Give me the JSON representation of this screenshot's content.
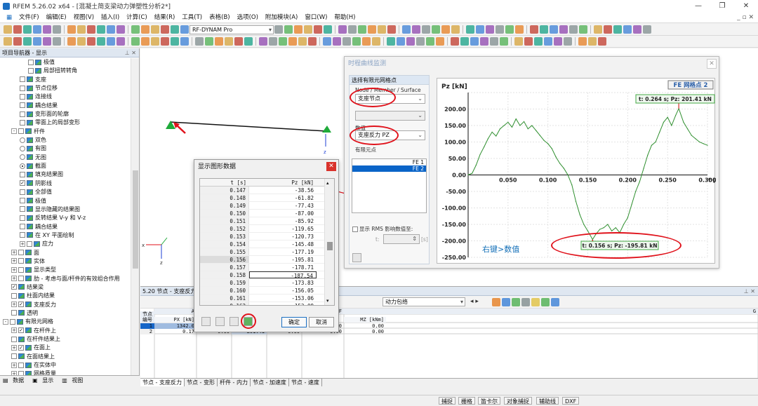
{
  "app": {
    "title": "RFEM 5.26.02 x64 - [混凝土简支梁动力弹塑性分析2*]"
  },
  "menu": [
    "文件(F)",
    "编辑(E)",
    "视图(V)",
    "插入(I)",
    "计算(C)",
    "结果(R)",
    "工具(T)",
    "表格(B)",
    "选项(O)",
    "附加模块(A)",
    "窗口(W)",
    "帮助(H)"
  ],
  "toolbar": {
    "module_select": "RF-DYNAM Pro"
  },
  "navigator": {
    "title": "项目导航器 - 显示",
    "items": [
      {
        "label": "极值",
        "indent": 3,
        "kind": "check",
        "checked": false
      },
      {
        "label": "局部扭转转角",
        "indent": 3,
        "kind": "check",
        "checked": false
      },
      {
        "label": "支座",
        "indent": 2,
        "kind": "check",
        "checked": false
      },
      {
        "label": "节点位移",
        "indent": 2,
        "kind": "check",
        "checked": false
      },
      {
        "label": "连接线",
        "indent": 2,
        "kind": "check",
        "checked": false
      },
      {
        "label": "耦合结果",
        "indent": 2,
        "kind": "check",
        "checked": false
      },
      {
        "label": "变形面的轮廓",
        "indent": 2,
        "kind": "check",
        "checked": false
      },
      {
        "label": "零面上的局部变形",
        "indent": 2,
        "kind": "check",
        "checked": false
      },
      {
        "label": "杆件",
        "indent": 1,
        "kind": "check",
        "checked": false,
        "expander": "-"
      },
      {
        "label": "双色",
        "indent": 2,
        "kind": "radio",
        "checked": false
      },
      {
        "label": "有图",
        "indent": 2,
        "kind": "radio",
        "checked": false
      },
      {
        "label": "无图",
        "indent": 2,
        "kind": "radio",
        "checked": false
      },
      {
        "label": "截面",
        "indent": 2,
        "kind": "radio",
        "checked": true
      },
      {
        "label": "填充结果图",
        "indent": 2,
        "kind": "check",
        "checked": false
      },
      {
        "label": "阴影线",
        "indent": 2,
        "kind": "check",
        "checked": true
      },
      {
        "label": "全部值",
        "indent": 2,
        "kind": "check",
        "checked": false
      },
      {
        "label": "极值",
        "indent": 2,
        "kind": "check",
        "checked": false
      },
      {
        "label": "显示隐藏的结果图",
        "indent": 2,
        "kind": "check",
        "checked": false
      },
      {
        "label": "反转结果 V-y 和 V-z",
        "indent": 2,
        "kind": "check",
        "checked": false
      },
      {
        "label": "耦合结果",
        "indent": 2,
        "kind": "check",
        "checked": false
      },
      {
        "label": "在 XY 平面绘制",
        "indent": 2,
        "kind": "check",
        "checked": false
      },
      {
        "label": "应力",
        "indent": 2,
        "kind": "check",
        "checked": false,
        "expander": "+"
      },
      {
        "label": "面",
        "indent": 1,
        "kind": "check",
        "checked": false,
        "expander": "+"
      },
      {
        "label": "实体",
        "indent": 1,
        "kind": "check",
        "checked": false,
        "expander": "+"
      },
      {
        "label": "显示类型",
        "indent": 1,
        "kind": "check",
        "checked": false,
        "expander": "+"
      },
      {
        "label": "肋 - 考虑与面/杆件的有效组合作用",
        "indent": 1,
        "kind": "check",
        "checked": false,
        "expander": "+"
      },
      {
        "label": "结果梁",
        "indent": 1,
        "kind": "check",
        "checked": true
      },
      {
        "label": "柱面内结果",
        "indent": 1,
        "kind": "check",
        "checked": false
      },
      {
        "label": "支座反力",
        "indent": 1,
        "kind": "check",
        "checked": true,
        "expander": "+"
      },
      {
        "label": "透明",
        "indent": 1,
        "kind": "check",
        "checked": false
      },
      {
        "label": "有限元网格",
        "indent": 0,
        "kind": "check",
        "checked": false,
        "expander": "-"
      },
      {
        "label": "在杆件上",
        "indent": 1,
        "kind": "check",
        "checked": true,
        "expander": "+"
      },
      {
        "label": "在杆件结果上",
        "indent": 1,
        "kind": "check",
        "checked": false
      },
      {
        "label": "在面上",
        "indent": 1,
        "kind": "check",
        "checked": true,
        "expander": "+"
      },
      {
        "label": "在面结果上",
        "indent": 1,
        "kind": "check",
        "checked": false
      },
      {
        "label": "在实体中",
        "indent": 1,
        "kind": "check",
        "checked": false,
        "expander": "+"
      },
      {
        "label": "网格质量",
        "indent": 1,
        "kind": "check",
        "checked": false,
        "expander": "+"
      }
    ],
    "tabs": [
      "数据",
      "显示",
      "视图"
    ]
  },
  "time_monitor": {
    "title": "时程曲线监测",
    "select_title": "选择有限元网格点",
    "member_label": "Node / Member / Surface",
    "member_value": "支座节点",
    "value_label": "数值",
    "value_value": "支座反力 PZ",
    "fe_label": "有限元点",
    "fe_items": [
      "FE 1",
      "FE 2"
    ],
    "fe_selected": 1,
    "rms_label": "显示 RMS 影响数值至:",
    "t_label": "t:",
    "t_unit": "[s]",
    "annotation": "右键>数值"
  },
  "chart_data": {
    "type": "line",
    "title": "FE 网格点 2",
    "ylabel": "Pz [kN]",
    "xlabel": "t [s]",
    "xlim": [
      0,
      0.3
    ],
    "ylim": [
      -250,
      250
    ],
    "xticks": [
      "0.050",
      "0.100",
      "0.150",
      "0.200",
      "0.250",
      "0.300"
    ],
    "yticks": [
      "200.00",
      "150.00",
      "100.00",
      "50.00",
      "0.00",
      "-50.00",
      "-100.00",
      "-150.00",
      "-200.00",
      "-250.00"
    ],
    "max_label": "t: 0.264 s; Pz: 201.41 kN",
    "min_label": "t: 0.156 s; Pz: -195.81 kN",
    "grid": true,
    "x": [
      0,
      0.005,
      0.01,
      0.015,
      0.02,
      0.025,
      0.03,
      0.035,
      0.04,
      0.045,
      0.05,
      0.055,
      0.06,
      0.065,
      0.07,
      0.075,
      0.08,
      0.085,
      0.09,
      0.095,
      0.1,
      0.105,
      0.11,
      0.115,
      0.12,
      0.125,
      0.13,
      0.135,
      0.14,
      0.145,
      0.15,
      0.156,
      0.16,
      0.165,
      0.17,
      0.175,
      0.18,
      0.185,
      0.19,
      0.195,
      0.2,
      0.205,
      0.21,
      0.215,
      0.22,
      0.225,
      0.23,
      0.235,
      0.24,
      0.245,
      0.25,
      0.255,
      0.26,
      0.264,
      0.27,
      0.275,
      0.28,
      0.285,
      0.29,
      0.295,
      0.3
    ],
    "y": [
      0,
      5,
      30,
      62,
      85,
      110,
      130,
      118,
      140,
      150,
      160,
      145,
      170,
      150,
      162,
      140,
      150,
      135,
      120,
      105,
      95,
      80,
      55,
      35,
      20,
      0,
      -30,
      -80,
      -120,
      -150,
      -170,
      -195.81,
      -180,
      -165,
      -160,
      -150,
      -170,
      -160,
      -175,
      -150,
      -130,
      -90,
      -50,
      -20,
      20,
      60,
      90,
      100,
      130,
      160,
      175,
      150,
      180,
      201.41,
      160,
      140,
      120,
      110,
      100,
      95,
      90
    ]
  },
  "data_dialog": {
    "title": "显示图形数据",
    "col_t": "t [s]",
    "col_p": "Pz [kN]",
    "rows": [
      [
        "0.147",
        "-38.56"
      ],
      [
        "0.148",
        "-61.82"
      ],
      [
        "0.149",
        "-77.43"
      ],
      [
        "0.150",
        "-87.00"
      ],
      [
        "0.151",
        "-85.92"
      ],
      [
        "0.152",
        "-119.65"
      ],
      [
        "0.153",
        "-120.73"
      ],
      [
        "0.154",
        "-145.48"
      ],
      [
        "0.155",
        "-177.19"
      ],
      [
        "0.156",
        "-195.81"
      ],
      [
        "0.157",
        "-178.71"
      ],
      [
        "0.158",
        "-187.54"
      ],
      [
        "0.159",
        "-173.83"
      ],
      [
        "0.160",
        "-156.05"
      ],
      [
        "0.161",
        "-153.06"
      ],
      [
        "0.162",
        "-153.09"
      ],
      [
        "0.163",
        "-115.18"
      ]
    ],
    "ok": "确定",
    "cancel": "取消"
  },
  "results": {
    "title": "5.20 节点 - 支座反力",
    "combo": "动力包络",
    "col_headers": [
      "A",
      "",
      "",
      "",
      "",
      "F",
      "G"
    ],
    "row_head": "节点\n编号",
    "sub_headers": [
      "PX [kN]",
      "",
      "",
      "",
      "",
      "MZ [kNm]"
    ],
    "rows": [
      {
        "no": "1",
        "px": "1342.0",
        "c2": "",
        "c3": "",
        "c4": "",
        "c5": "0.00",
        "mz": "0.00"
      },
      {
        "no": "2",
        "px": "0.17",
        "c2": "0.00",
        "c3": "201.41",
        "c4": "0.00",
        "c5": "0.00",
        "mz": "0.00"
      }
    ],
    "tabs": [
      "节点 - 支座反力",
      "节点 - 变形",
      "杆件 - 内力",
      "节点 - 加速度",
      "节点 - 速度"
    ]
  },
  "statusbar": [
    "捕捉",
    "栅格",
    "笛卡尔",
    "对象捕捉",
    "辅助线",
    "DXF"
  ]
}
